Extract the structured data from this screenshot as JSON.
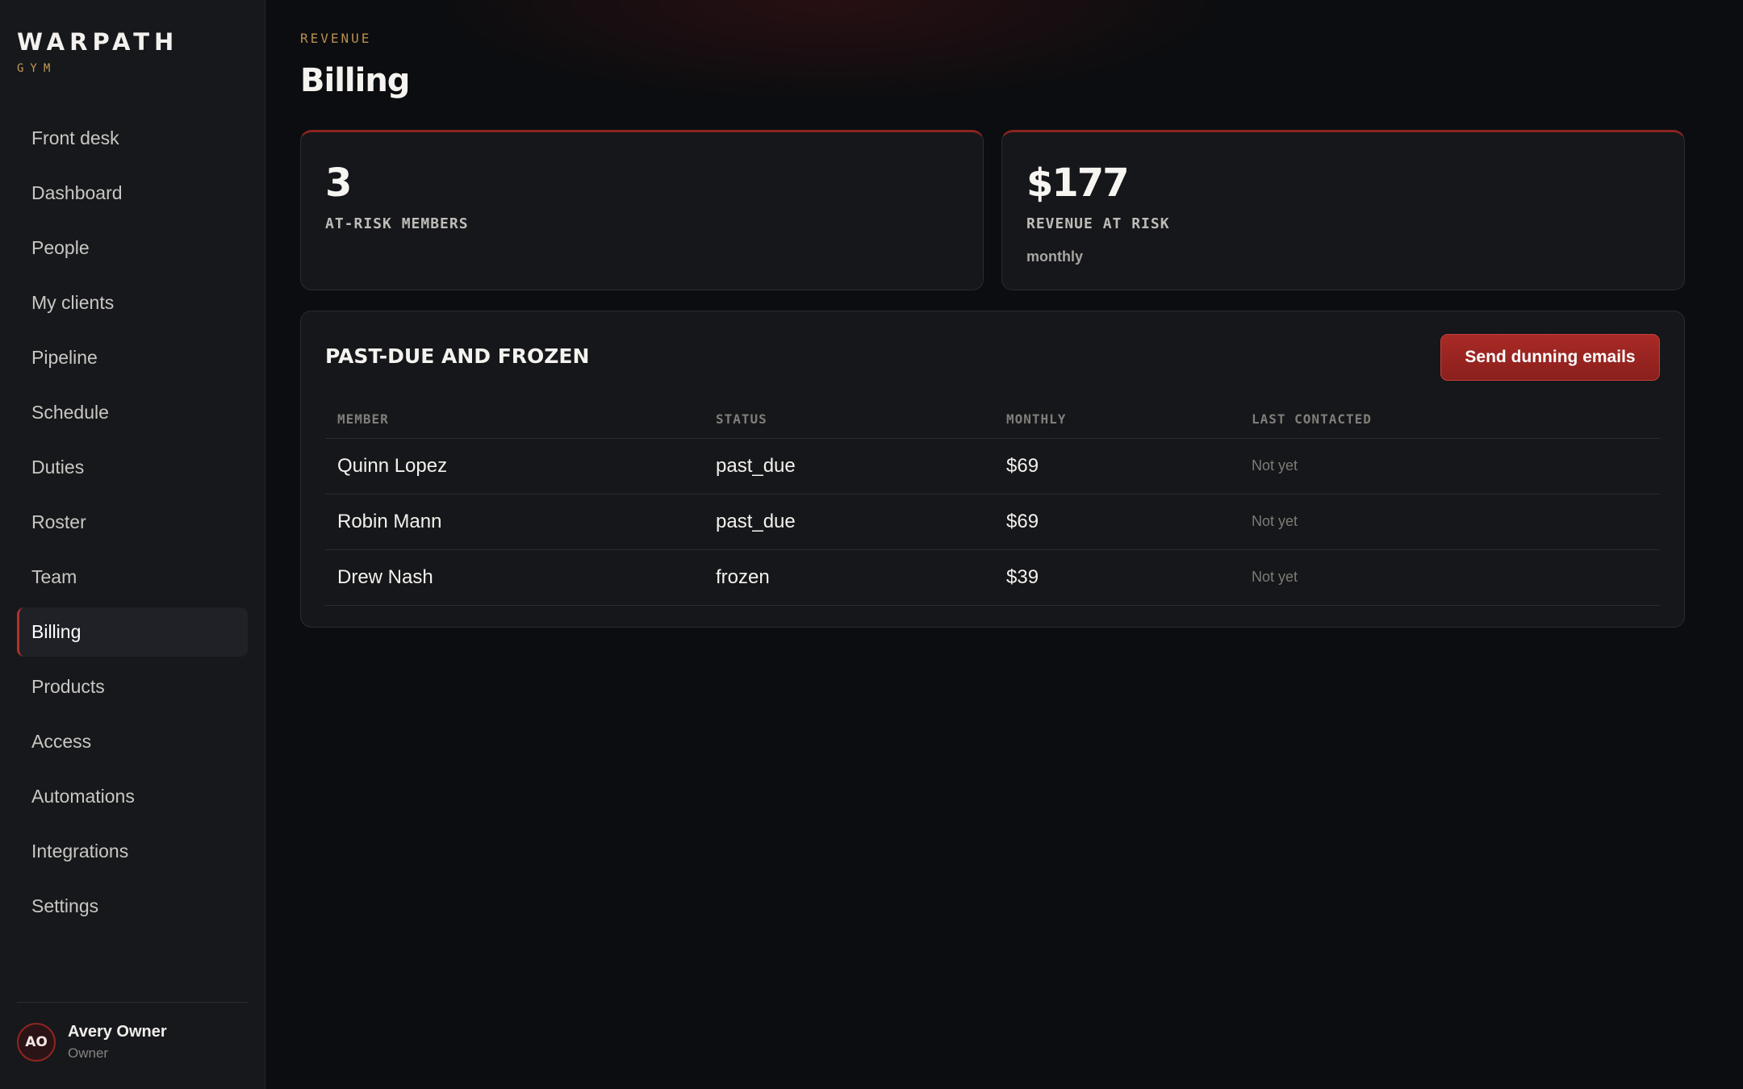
{
  "brand": {
    "name": "WARPATH",
    "sub": "GYM"
  },
  "nav": {
    "items": [
      {
        "label": "Front desk",
        "active": false
      },
      {
        "label": "Dashboard",
        "active": false
      },
      {
        "label": "People",
        "active": false
      },
      {
        "label": "My clients",
        "active": false
      },
      {
        "label": "Pipeline",
        "active": false
      },
      {
        "label": "Schedule",
        "active": false
      },
      {
        "label": "Duties",
        "active": false
      },
      {
        "label": "Roster",
        "active": false
      },
      {
        "label": "Team",
        "active": false
      },
      {
        "label": "Billing",
        "active": true
      },
      {
        "label": "Products",
        "active": false
      },
      {
        "label": "Access",
        "active": false
      },
      {
        "label": "Automations",
        "active": false
      },
      {
        "label": "Integrations",
        "active": false
      },
      {
        "label": "Settings",
        "active": false
      }
    ]
  },
  "user": {
    "initials": "AO",
    "name": "Avery Owner",
    "role": "Owner"
  },
  "header": {
    "eyebrow": "REVENUE",
    "title": "Billing"
  },
  "stats": [
    {
      "value": "3",
      "label": "AT-RISK MEMBERS",
      "sub": ""
    },
    {
      "value": "$177",
      "label": "REVENUE AT RISK",
      "sub": "monthly"
    }
  ],
  "past_due": {
    "title": "PAST-DUE AND FROZEN",
    "action_label": "Send dunning emails",
    "columns": [
      "MEMBER",
      "STATUS",
      "MONTHLY",
      "LAST CONTACTED"
    ],
    "rows": [
      {
        "member": "Quinn Lopez",
        "status": "past_due",
        "monthly": "$69",
        "last_contacted": "Not yet"
      },
      {
        "member": "Robin Mann",
        "status": "past_due",
        "monthly": "$69",
        "last_contacted": "Not yet"
      },
      {
        "member": "Drew Nash",
        "status": "frozen",
        "monthly": "$39",
        "last_contacted": "Not yet"
      }
    ]
  },
  "colors": {
    "accent": "#a92a26",
    "gold": "#c39a55",
    "background": "#0c0d10",
    "sidebar": "#16181b"
  }
}
